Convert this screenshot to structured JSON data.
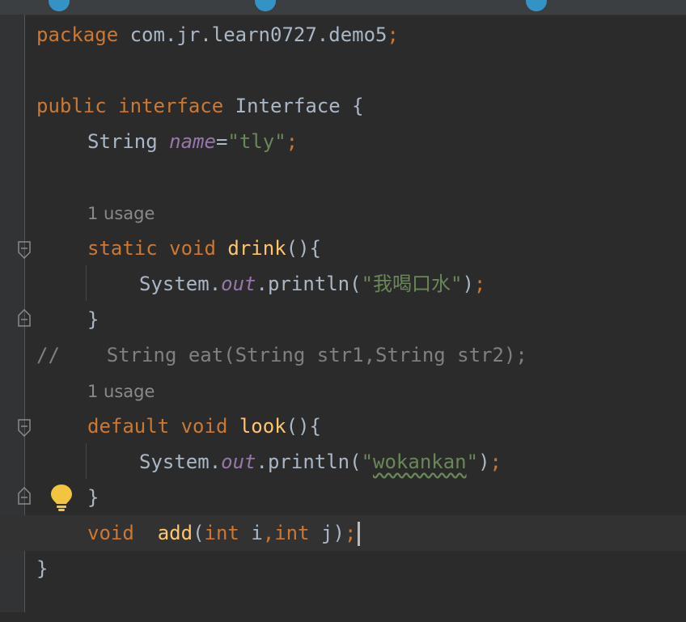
{
  "editor": {
    "lines": {
      "package_kw": "package",
      "package_name": " com.jr.learn0727.demo5",
      "semicolon": ";",
      "public_kw": "public",
      "interface_kw": "interface",
      "interface_name": " Interface {",
      "string_type": "String",
      "field_name": "name",
      "equals": "=",
      "field_value": "\"tly\"",
      "usage_hint_1": "1 usage",
      "static_kw": "static",
      "void_kw": "void",
      "drink_fn": "drink",
      "parens_brace": "(){",
      "system": "System.",
      "out": "out",
      "println": ".println(",
      "drink_str": "\"我喝口水\"",
      "close_paren": ")",
      "close_brace": "}",
      "comment_line": "//    String eat(String str1,String str2);",
      "usage_hint_2": "1 usage",
      "default_kw": "default",
      "look_fn": "look",
      "look_str_open": "\"",
      "look_str_word": "wokankan",
      "look_str_close": "\"",
      "add_fn": "add",
      "open_paren": "(",
      "int_kw": "int",
      "param_i": " i",
      "comma": ",",
      "param_j": " j",
      "final_brace": "}"
    }
  },
  "colors": {
    "background": "#2b2b2b",
    "keyword": "#cc7832",
    "function": "#ffc66d",
    "string": "#6a8759",
    "field": "#9876aa",
    "comment": "#808080",
    "text": "#a9b7c6"
  },
  "icons": {
    "bulb": "lightbulb-icon",
    "fold": "fold-marker-icon"
  }
}
